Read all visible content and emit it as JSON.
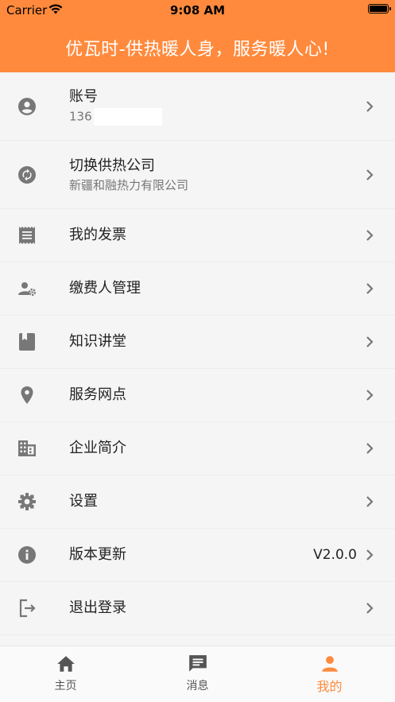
{
  "status_bar": {
    "carrier": "Carrier",
    "time": "9:08 AM"
  },
  "header": {
    "slogan": "优瓦时-供热暖人身，服务暖人心!"
  },
  "menu": {
    "account": {
      "label": "账号",
      "phone": "136"
    },
    "switch_company": {
      "label": "切换供热公司",
      "company": "新疆和融热力有限公司"
    },
    "invoice": {
      "label": "我的发票"
    },
    "payer": {
      "label": "缴费人管理"
    },
    "knowledge": {
      "label": "知识讲堂"
    },
    "service_points": {
      "label": "服务网点"
    },
    "company_intro": {
      "label": "企业简介"
    },
    "settings": {
      "label": "设置"
    },
    "version": {
      "label": "版本更新",
      "value": "V2.0.0"
    },
    "logout": {
      "label": "退出登录"
    }
  },
  "tabbar": {
    "home": "主页",
    "messages": "消息",
    "mine": "我的"
  },
  "colors": {
    "accent": "#ff8a3d",
    "icon": "#777777"
  }
}
